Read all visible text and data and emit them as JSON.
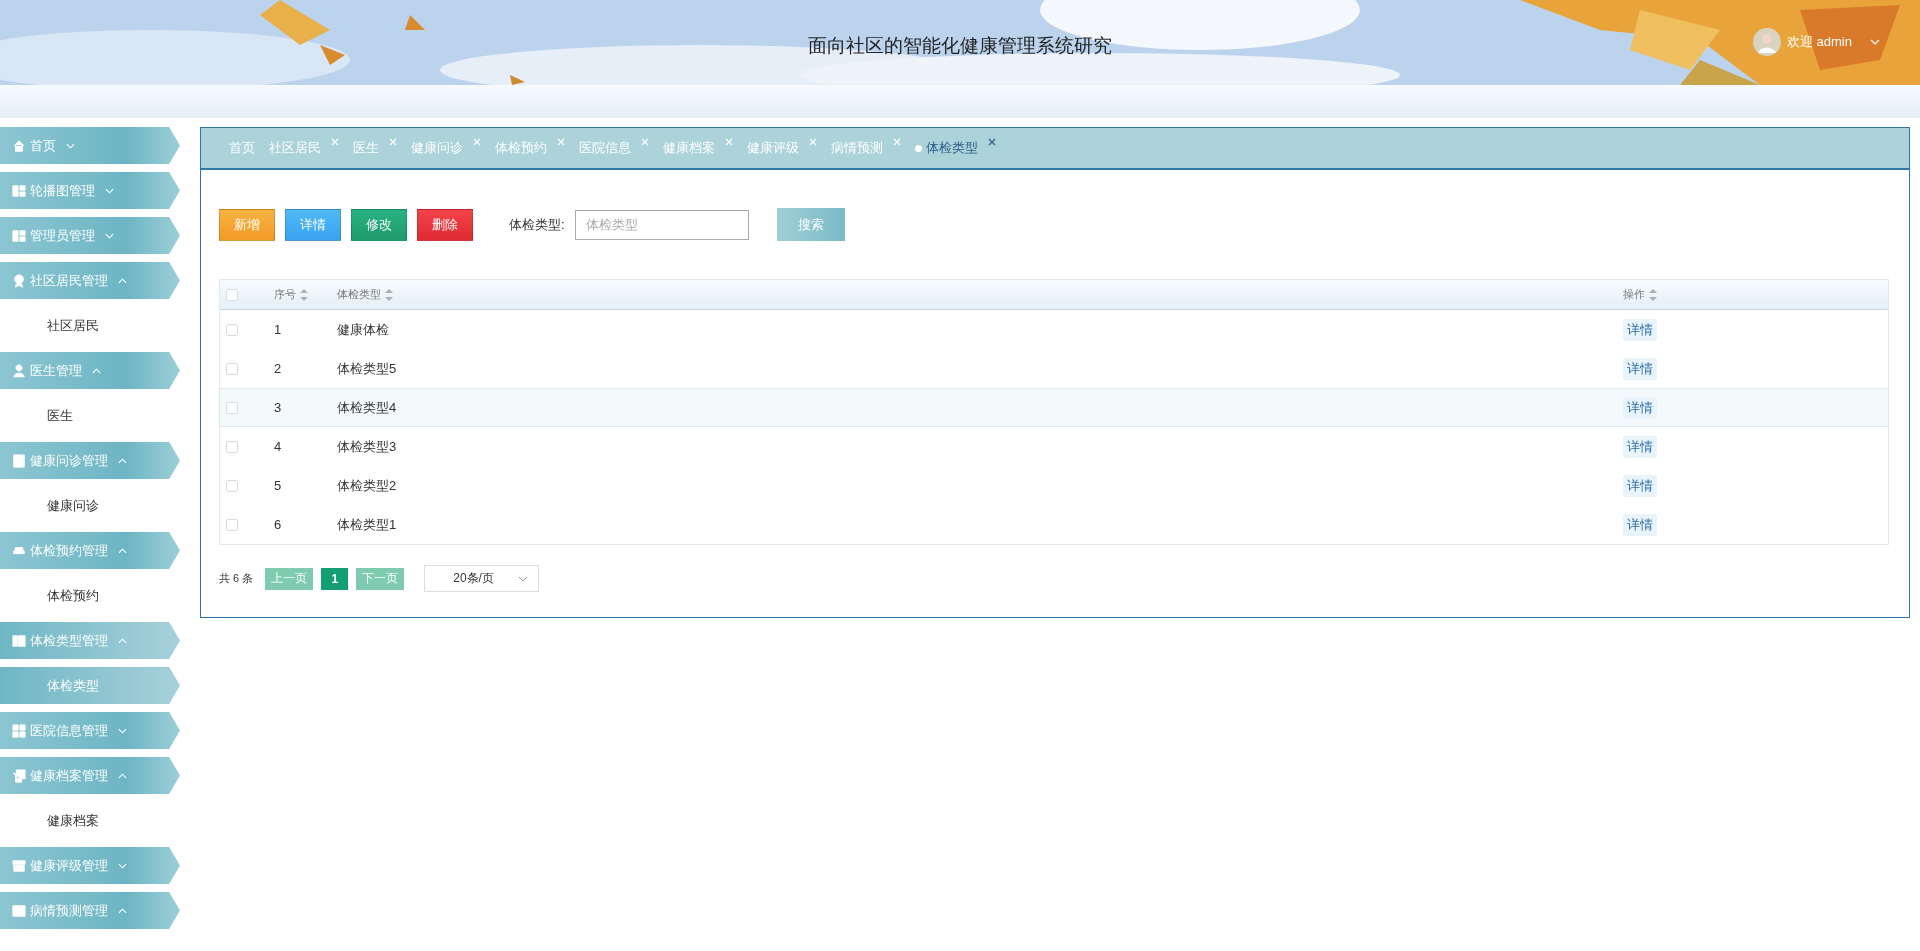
{
  "header": {
    "title": "面向社区的智能化健康管理系统研究",
    "user": {
      "greeting": "欢迎 admin"
    }
  },
  "sidebar": {
    "groups": [
      {
        "label": "首页",
        "expanded": false,
        "selected": false
      },
      {
        "label": "轮播图管理",
        "expanded": false,
        "selected": false
      },
      {
        "label": "管理员管理",
        "expanded": false,
        "selected": false
      },
      {
        "label": "社区居民管理",
        "expanded": true,
        "selected": false,
        "children": [
          {
            "label": "社区居民",
            "selected": false
          }
        ]
      },
      {
        "label": "医生管理",
        "expanded": true,
        "selected": false,
        "children": [
          {
            "label": "医生",
            "selected": false
          }
        ]
      },
      {
        "label": "健康问诊管理",
        "expanded": true,
        "selected": false,
        "children": [
          {
            "label": "健康问诊",
            "selected": false
          }
        ]
      },
      {
        "label": "体检预约管理",
        "expanded": true,
        "selected": false,
        "children": [
          {
            "label": "体检预约",
            "selected": false
          }
        ]
      },
      {
        "label": "体检类型管理",
        "expanded": true,
        "selected": true,
        "children": [
          {
            "label": "体检类型",
            "selected": true
          }
        ]
      },
      {
        "label": "医院信息管理",
        "expanded": false,
        "selected": false
      },
      {
        "label": "健康档案管理",
        "expanded": true,
        "selected": false,
        "children": [
          {
            "label": "健康档案",
            "selected": false
          }
        ]
      },
      {
        "label": "健康评级管理",
        "expanded": false,
        "selected": false
      },
      {
        "label": "病情预测管理",
        "expanded": true,
        "selected": false
      }
    ]
  },
  "tabs": [
    {
      "label": "首页",
      "closable": false,
      "selected": false
    },
    {
      "label": "社区居民",
      "closable": true,
      "selected": false
    },
    {
      "label": "医生",
      "closable": true,
      "selected": false
    },
    {
      "label": "健康问诊",
      "closable": true,
      "selected": false
    },
    {
      "label": "体检预约",
      "closable": true,
      "selected": false
    },
    {
      "label": "医院信息",
      "closable": true,
      "selected": false
    },
    {
      "label": "健康档案",
      "closable": true,
      "selected": false
    },
    {
      "label": "健康评级",
      "closable": true,
      "selected": false
    },
    {
      "label": "病情预测",
      "closable": true,
      "selected": false
    },
    {
      "label": "体检类型",
      "closable": true,
      "selected": true
    }
  ],
  "toolbar": {
    "buttons": [
      {
        "label": "新增",
        "kind": "add"
      },
      {
        "label": "详情",
        "kind": "detail"
      },
      {
        "label": "修改",
        "kind": "edit"
      },
      {
        "label": "删除",
        "kind": "delete"
      }
    ],
    "search": {
      "label": "体检类型:",
      "placeholder": "体检类型",
      "button": "搜索"
    }
  },
  "table": {
    "all_checked": false,
    "columns": [
      "序号",
      "体检类型",
      "操作"
    ],
    "rows": [
      {
        "index": "1",
        "type": "健康体检",
        "action": "详情",
        "checked": false,
        "highlighted": false
      },
      {
        "index": "2",
        "type": "体检类型5",
        "action": "详情",
        "checked": false,
        "highlighted": false
      },
      {
        "index": "3",
        "type": "体检类型4",
        "action": "详情",
        "checked": false,
        "highlighted": true
      },
      {
        "index": "4",
        "type": "体检类型3",
        "action": "详情",
        "checked": false,
        "highlighted": false
      },
      {
        "index": "5",
        "type": "体检类型2",
        "action": "详情",
        "checked": false,
        "highlighted": false
      },
      {
        "index": "6",
        "type": "体检类型1",
        "action": "详情",
        "checked": false,
        "highlighted": false
      }
    ]
  },
  "pagination": {
    "total": "共 6 条",
    "prev": "上一页",
    "pages": [
      {
        "label": "1",
        "selected": true
      }
    ],
    "next": "下一页",
    "page_size": "20条/页"
  }
}
